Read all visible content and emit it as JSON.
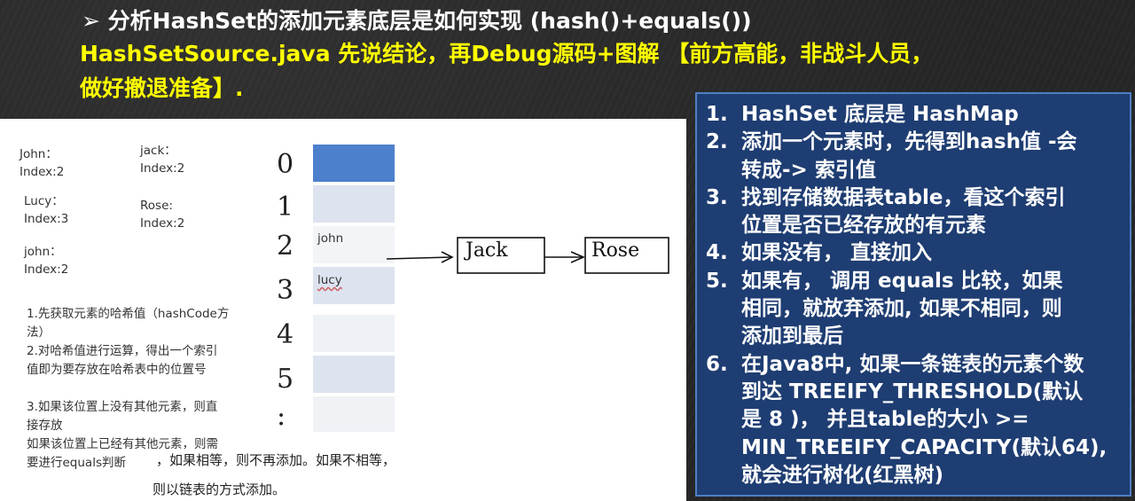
{
  "header": {
    "title": "➢ 分析HashSet的添加元素底层是如何实现 (hash()+equals())",
    "line1": "HashSetSource.java  先说结论，再Debug源码+图解 【前方高能，非战斗人员，",
    "line2": "做好撤退准备】."
  },
  "diagram": {
    "notes": [
      {
        "id": "john1",
        "lines": [
          "John：",
          "Index:2"
        ]
      },
      {
        "id": "jack",
        "lines": [
          "jack：",
          "Index:2"
        ]
      },
      {
        "id": "lucy",
        "lines": [
          "Lucy：",
          "Index:3"
        ]
      },
      {
        "id": "rose",
        "lines": [
          "Rose:",
          "Index:2"
        ]
      },
      {
        "id": "john2",
        "lines": [
          "john：",
          "Index:2"
        ]
      }
    ],
    "indices": [
      "0",
      "1",
      "2",
      "3",
      "4",
      "5",
      ":"
    ],
    "slot_labels": [
      "john",
      "lucy"
    ],
    "chain": [
      "Jack",
      "Rose"
    ],
    "steps": [
      "1.先获取元素的哈希值（hashCode方",
      "法）",
      "2.对哈希值进行运算，得出一个索引",
      "值即为要存放在哈希表中的位置号",
      "",
      "3.如果该位置上没有其他元素，则直",
      "接存放",
      "如果该位置上已经有其他元素，则需",
      "要进行equals判断"
    ],
    "extra": [
      "，如果相等，则不再添加。如果不相等，",
      "则以链表的方式添加。"
    ]
  },
  "summary": [
    {
      "num": "1.",
      "text": "HashSet 底层是 HashMap"
    },
    {
      "num": "2.",
      "text": "添加一个元素时，先得到hash值 -会\n转成-> 索引值"
    },
    {
      "num": "3.",
      "text": "找到存储数据表table，看这个索引\n位置是否已经存放的有元素"
    },
    {
      "num": "4.",
      "text": "如果没有， 直接加入"
    },
    {
      "num": "5.",
      "text": "如果有， 调用 equals 比较，如果\n相同，就放弃添加, 如果不相同，则\n添加到最后"
    },
    {
      "num": "6.",
      "text": "在Java8中, 如果一条链表的元素个数\n到达 TREEIFY_THRESHOLD(默认\n是 8 )， 并且table的大小 >=\nMIN_TREEIFY_CAPACITY(默认64),\n就会进行树化(红黑树)"
    }
  ],
  "colors": {
    "title": "#ffffff",
    "highlight": "#ffff00",
    "box_bg": "#1e3d72",
    "box_border": "#4f7fc4",
    "slot_top": "#4c7fcc",
    "slot": "#dde3ef"
  }
}
